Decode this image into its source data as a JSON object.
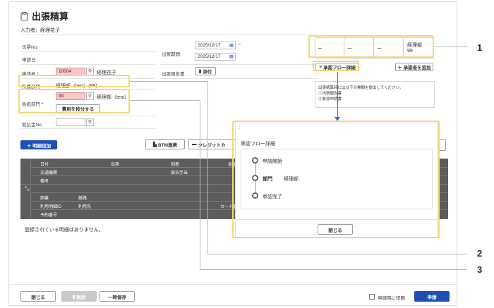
{
  "page": {
    "title": "出張精算",
    "entered_by": "入力者：経理花子"
  },
  "form": {
    "slip_no_label": "伝票No.",
    "application_date_label": "申請日",
    "applicant_label": "申請者",
    "required_mark": "*",
    "applicant_code": "10004",
    "applicant_name": "経理花子",
    "department_label": "所属部門",
    "department_value": "経理部（test）(99)",
    "burden_dept_label": "負担部門",
    "burden_dept_code": "99",
    "burden_dept_name": "経理部（test）",
    "split_cost_button": "費用を按分する",
    "advance_no_label": "仮払金No.",
    "trip_period_label": "出張期間",
    "trip_start": "2025/12/17",
    "trip_end": "2025/12/17",
    "period_separator": "~",
    "trip_report_label": "出張報告書",
    "attach_button": "添付"
  },
  "approval": {
    "cells": [
      "ー",
      "ー",
      "ー"
    ],
    "dept_name": "経理部",
    "dept_code": "99",
    "flow_detail_button": "承認フロー詳細",
    "add_approver_button": "＋ 承認者を追加",
    "notice_line1": "出張精算時には以下の書類を提出してください。",
    "notice_line2": "①出張報告書",
    "notice_line3": "②参加申請書"
  },
  "toolbar": {
    "add_detail_button": "＋ 明細追加",
    "btm_button": "BTM連携",
    "credit_button": "クレジットカ"
  },
  "table": {
    "headers": {
      "date": "日付",
      "departure": "出発",
      "arrival": "到着",
      "amount": "金額/Ko",
      "transport": "交通機関",
      "route_fee": "宿泊手当",
      "remarks": "備考",
      "category": "距離",
      "section": "経路",
      "usage_id": "利用明細ID",
      "usage_dest": "利用先",
      "card_no": "カード番号",
      "reservation_no": "予約番号"
    },
    "empty_message": "登録されている明細はありません。"
  },
  "modal": {
    "title": "承認フロー詳細",
    "steps": [
      {
        "label": "申請開始",
        "detail": ""
      },
      {
        "label": "部門",
        "detail": "経理部"
      },
      {
        "label": "承認完了",
        "detail": ""
      }
    ],
    "close_button": "閉じる"
  },
  "footer": {
    "close_button": "閉じる",
    "delete_button": "削除",
    "save_draft_button": "一時保存",
    "print_checkbox_label": "申請時に印刷",
    "submit_button": "申請"
  },
  "callouts": [
    "1",
    "2",
    "3"
  ],
  "colors": {
    "primary": "#1e4fb4",
    "highlight": "#f6d774",
    "required_field": "#f9c7c7",
    "table_header": "#5c5c5c"
  }
}
